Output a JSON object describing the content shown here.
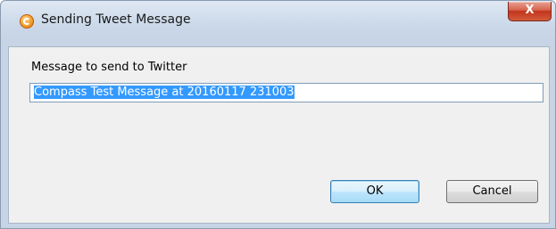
{
  "window": {
    "title": "Sending Tweet Message",
    "app_icon": "app-logo-icon",
    "close_glyph": "X"
  },
  "form": {
    "prompt_label": "Message to send to Twitter",
    "message_value": "Compass Test Message at 20160117 231003"
  },
  "buttons": {
    "ok_label": "OK",
    "cancel_label": "Cancel"
  },
  "colors": {
    "selection": "#3399ff",
    "close_button": "#c2351c",
    "default_button_border": "#3c7fb1"
  }
}
